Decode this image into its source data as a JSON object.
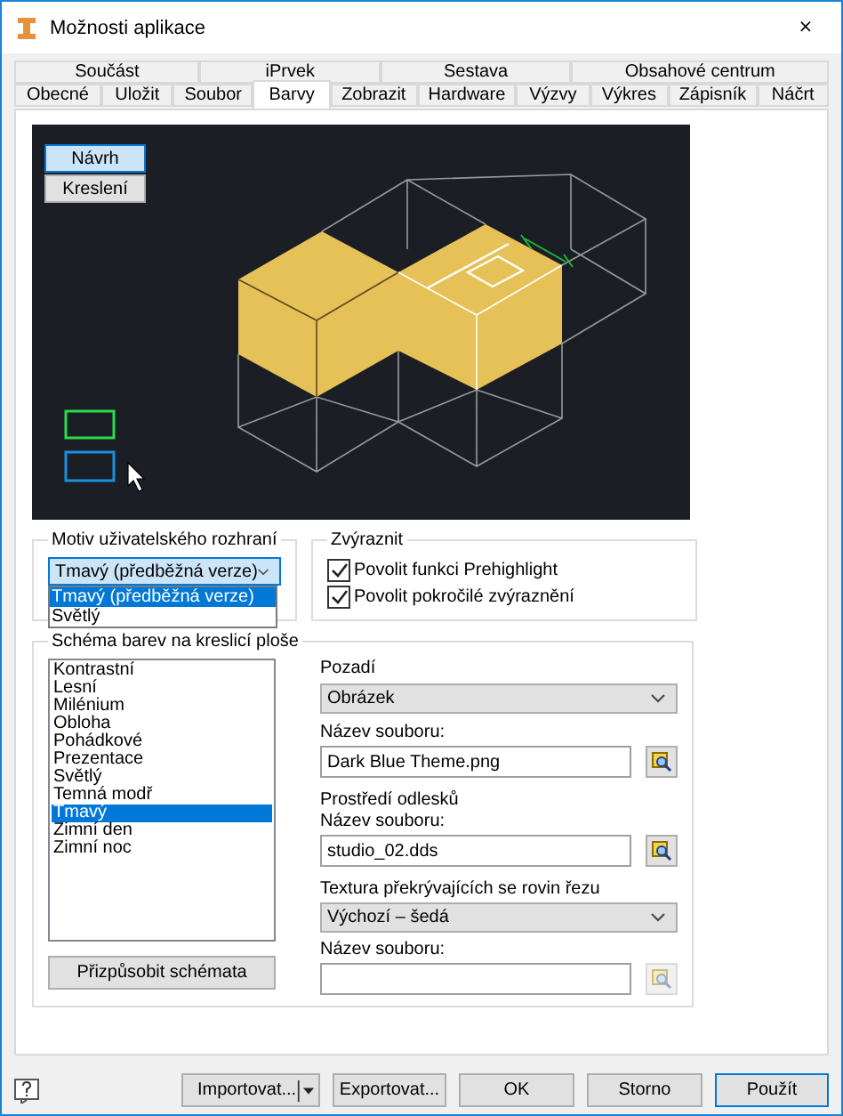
{
  "window": {
    "title": "Možnosti aplikace",
    "close": "×"
  },
  "tab_rows": [
    {
      "tabs": [
        {
          "label": "Součást",
          "selected": false
        },
        {
          "label": "iPrvek",
          "selected": false
        },
        {
          "label": "Sestava",
          "selected": false
        },
        {
          "label": "Obsahové centrum",
          "selected": false
        }
      ]
    },
    {
      "tabs": [
        {
          "label": "Obecné",
          "selected": false
        },
        {
          "label": "Uložit",
          "selected": false
        },
        {
          "label": "Soubor",
          "selected": false
        },
        {
          "label": "Barvy",
          "selected": true
        },
        {
          "label": "Zobrazit",
          "selected": false
        },
        {
          "label": "Hardware",
          "selected": false
        },
        {
          "label": "Výzvy",
          "selected": false
        },
        {
          "label": "Výkres",
          "selected": false
        },
        {
          "label": "Zápisník",
          "selected": false
        },
        {
          "label": "Náčrt",
          "selected": false
        }
      ]
    }
  ],
  "preview": {
    "modes": [
      {
        "label": "Návrh",
        "selected": true
      },
      {
        "label": "Kreslení",
        "selected": false
      }
    ]
  },
  "ui_theme": {
    "title": "Motiv uživatelského rozhraní",
    "value": "Tmavý (předběžná verze)",
    "expanded": true,
    "options": [
      {
        "label": "Tmavý (předběžná verze)",
        "selected": true
      },
      {
        "label": "Světlý",
        "selected": false
      }
    ]
  },
  "highlight": {
    "title": "Zvýraznit",
    "options": [
      {
        "label": "Povolit funkci Prehighlight",
        "checked": true
      },
      {
        "label": "Povolit pokročilé zvýraznění",
        "checked": true
      }
    ]
  },
  "color_scheme": {
    "title": "Schéma barev na kreslicí ploše",
    "schemes": [
      {
        "label": "Kontrastní",
        "selected": false
      },
      {
        "label": "Lesní",
        "selected": false
      },
      {
        "label": "Milénium",
        "selected": false
      },
      {
        "label": "Obloha",
        "selected": false
      },
      {
        "label": "Pohádkové",
        "selected": false
      },
      {
        "label": "Prezentace",
        "selected": false
      },
      {
        "label": "Světlý",
        "selected": false
      },
      {
        "label": "Temná modř",
        "selected": false
      },
      {
        "label": "Tmavý",
        "selected": true
      },
      {
        "label": "Zimní den",
        "selected": false
      },
      {
        "label": "Zimní noc",
        "selected": false
      }
    ],
    "customize_button": "Přizpůsobit schémata",
    "background": {
      "label": "Pozadí",
      "value": "Obrázek",
      "file_label": "Název souboru:",
      "file": "Dark Blue Theme.png",
      "browse_disabled": false
    },
    "reflection": {
      "label": "Prostředí odlesků",
      "file_label": "Název souboru:",
      "file": "studio_02.dds",
      "browse_disabled": false
    },
    "section_texture": {
      "label": "Textura překrývajících se rovin řezu",
      "value": "Výchozí – šedá",
      "file_label": "Název souboru:",
      "browse_disabled": true
    }
  },
  "buttons": [
    {
      "label": "Importovat...",
      "kind": "split"
    },
    {
      "label": "Exportovat...",
      "kind": "normal"
    },
    {
      "label": "OK",
      "kind": "normal"
    },
    {
      "label": "Storno",
      "kind": "normal"
    },
    {
      "label": "Použít",
      "kind": "default"
    }
  ]
}
